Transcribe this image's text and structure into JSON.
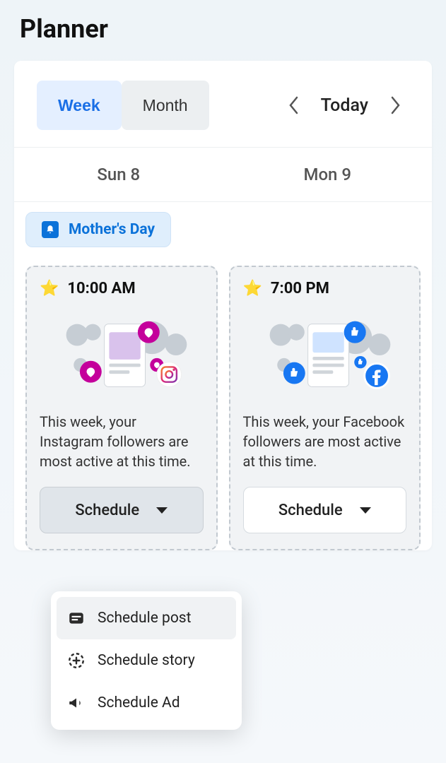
{
  "title": "Planner",
  "view_toggle": {
    "week": "Week",
    "month": "Month",
    "active": "week"
  },
  "nav": {
    "today_label": "Today"
  },
  "days": [
    {
      "label": "Sun 8"
    },
    {
      "label": "Mon 9"
    }
  ],
  "event": {
    "name": "Mother's Day"
  },
  "cards": [
    {
      "time": "10:00 AM",
      "platform": "instagram",
      "text": "This week, your Instagram followers are most active at this time.",
      "button": "Schedule",
      "button_style": "primary"
    },
    {
      "time": "7:00 PM",
      "platform": "facebook",
      "text": "This week, your Facebook followers are most active at this time.",
      "button": "Schedule",
      "button_style": "secondary"
    }
  ],
  "dropdown": {
    "items": [
      {
        "label": "Schedule post",
        "icon": "post",
        "active": true
      },
      {
        "label": "Schedule story",
        "icon": "story",
        "active": false
      },
      {
        "label": "Schedule Ad",
        "icon": "ad",
        "active": false
      }
    ]
  },
  "colors": {
    "accent_blue": "#1a6fe6",
    "badge_bg": "#dfeefc",
    "instagram_pink": "#d6249f",
    "facebook_blue": "#1877f2"
  }
}
